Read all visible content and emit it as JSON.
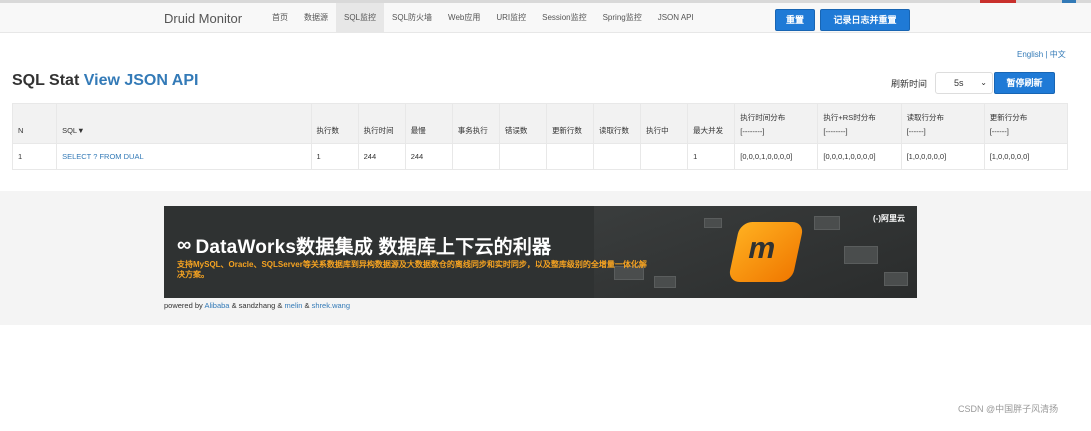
{
  "nav": {
    "brand": "Druid Monitor",
    "items": [
      {
        "label": "首页",
        "active": false
      },
      {
        "label": "数据源",
        "active": false
      },
      {
        "label": "SQL监控",
        "active": true
      },
      {
        "label": "SQL防火墙",
        "active": false
      },
      {
        "label": "Web应用",
        "active": false
      },
      {
        "label": "URI监控",
        "active": false
      },
      {
        "label": "Session监控",
        "active": false
      },
      {
        "label": "Spring监控",
        "active": false
      },
      {
        "label": "JSON API",
        "active": false
      }
    ],
    "reset_label": "重置",
    "log_reset_label": "记录日志并重置"
  },
  "lang": {
    "english": "English",
    "separator": " | ",
    "chinese": "中文"
  },
  "page": {
    "title": "SQL Stat",
    "title_link": "View JSON API",
    "refresh_label": "刷新时间",
    "refresh_value": "5s",
    "pause_label": "暂停刷新"
  },
  "table": {
    "headers": [
      "N",
      "SQL▼",
      "执行数",
      "执行时间",
      "最慢",
      "事务执行",
      "错误数",
      "更新行数",
      "读取行数",
      "执行中",
      "最大并发"
    ],
    "dist_headers": [
      {
        "title": "执行时间分布",
        "sub": "[--------]"
      },
      {
        "title": "执行+RS时分布",
        "sub": "[--------]"
      },
      {
        "title": "读取行分布",
        "sub": "[------]"
      },
      {
        "title": "更新行分布",
        "sub": "[------]"
      }
    ],
    "rows": [
      [
        "1",
        "SELECT ? FROM DUAL",
        "1",
        "244",
        "244",
        "",
        "",
        "",
        "",
        "",
        "1",
        "[0,0,0,1,0,0,0,0]",
        "[0,0,0,1,0,0,0,0]",
        "[1,0,0,0,0,0]",
        "[1,0,0,0,0,0]"
      ]
    ]
  },
  "banner": {
    "headline": "DataWorks数据集成 数据库上下云的利器",
    "subtext": "支持MySQL、Oracle、SQLServer等关系数据库到异构数据源及大数据数仓的离线同步和实时同步，以及整库级别的全增量一体化解决方案。",
    "brand": "(-)阿里云"
  },
  "powered": {
    "prefix": "powered by ",
    "alibaba": "Alibaba",
    "middle": " & sandzhang & ",
    "melin": "melin",
    "amp": " & ",
    "shrek": "shrek.wang"
  },
  "watermark": "CSDN @中国胖子风清扬",
  "colors": {
    "primary": "#1f7ad6",
    "link": "#337ab7",
    "banner_bg": "#2f3232",
    "banner_accent": "#f6a321"
  }
}
